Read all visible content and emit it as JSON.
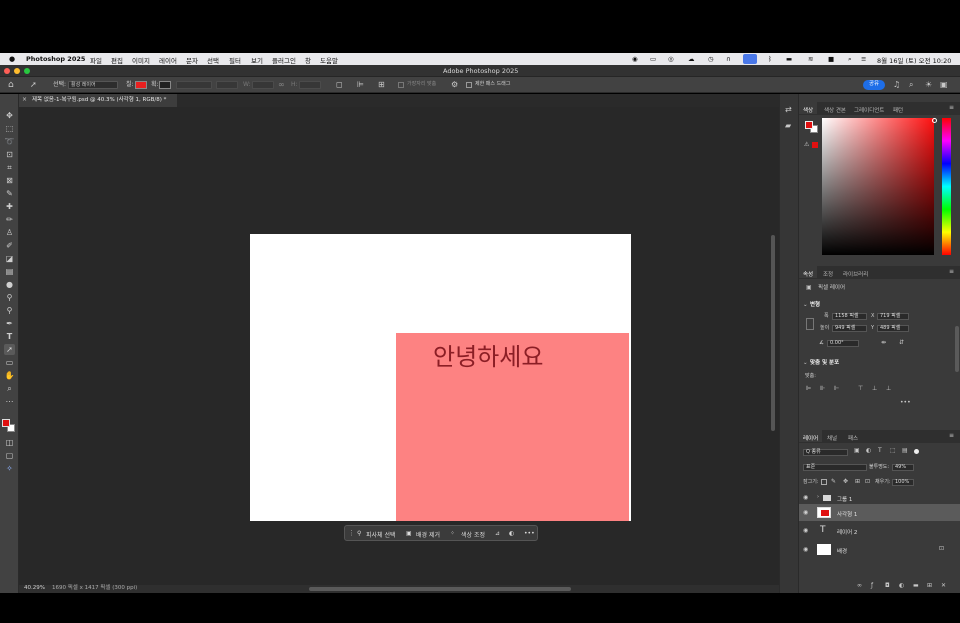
{
  "menubar": {
    "app_name": "Photoshop 2025",
    "items": [
      "파일",
      "편집",
      "이미지",
      "레이어",
      "문자",
      "선택",
      "필터",
      "보기",
      "플러그인",
      "창",
      "도움말"
    ],
    "clock": "8월 16일 (토) 오전 10:20"
  },
  "window": {
    "title": "Adobe Photoshop 2025",
    "share_label": "공유"
  },
  "options": {
    "select_label": "선택:",
    "select_value": "활성 레이어",
    "fill_label": "칠:",
    "stroke_label": "획:",
    "width_label": "W:",
    "height_label": "H:",
    "align_edges_label": "가장자리 맞춤",
    "constrain_label": "제한 패스 드래그",
    "fill_color": "#e82020"
  },
  "document": {
    "tab_label": "제목 없음-1-복구됨.psd @ 40.3% (사각형 1, RGB/8) *",
    "text_layer_content": "안녕하세요",
    "rect_color": "#fd8282",
    "text_color": "#8b1e25"
  },
  "context_bar": {
    "select_subject": "피사체 선택",
    "remove_bg": "배경 제거",
    "color_adjust": "색상 조정"
  },
  "status": {
    "zoom": "40.29%",
    "doc_size": "1690 픽셀 x 1417 픽셀 (300 ppi)"
  },
  "color_panel": {
    "tabs": [
      "색상",
      "색상 견본",
      "그레이디언트",
      "패턴"
    ],
    "foreground": "#e01010",
    "background": "#ffffff"
  },
  "properties_panel": {
    "tabs": [
      "속성",
      "조정",
      "라이브러리"
    ],
    "layer_type": "픽셀 레이어",
    "transform_header": "변형",
    "width_label": "폭",
    "width_value": "1158 픽셀",
    "x_label": "X",
    "x_value": "719 픽셀",
    "height_label": "높이",
    "height_value": "949 픽셀",
    "y_label": "Y",
    "y_value": "489 픽셀",
    "angle_value": "0.00°",
    "align_header": "맞춤 및 분포",
    "align_label": "맞춤:"
  },
  "layers_panel": {
    "tabs": [
      "레이어",
      "채널",
      "패스"
    ],
    "filter_kind": "Q 종류",
    "blend_mode": "표준",
    "opacity_label": "불투명도:",
    "opacity_value": "49%",
    "lock_label": "잠그기:",
    "fill_label": "채우기:",
    "fill_value": "100%",
    "layers": [
      {
        "name": "그룹 1",
        "type": "group",
        "selected": false
      },
      {
        "name": "사각형 1",
        "type": "shape",
        "selected": true
      },
      {
        "name": "레이어 2",
        "type": "text",
        "selected": false
      },
      {
        "name": "배경",
        "type": "background",
        "selected": false,
        "locked": true
      }
    ]
  }
}
